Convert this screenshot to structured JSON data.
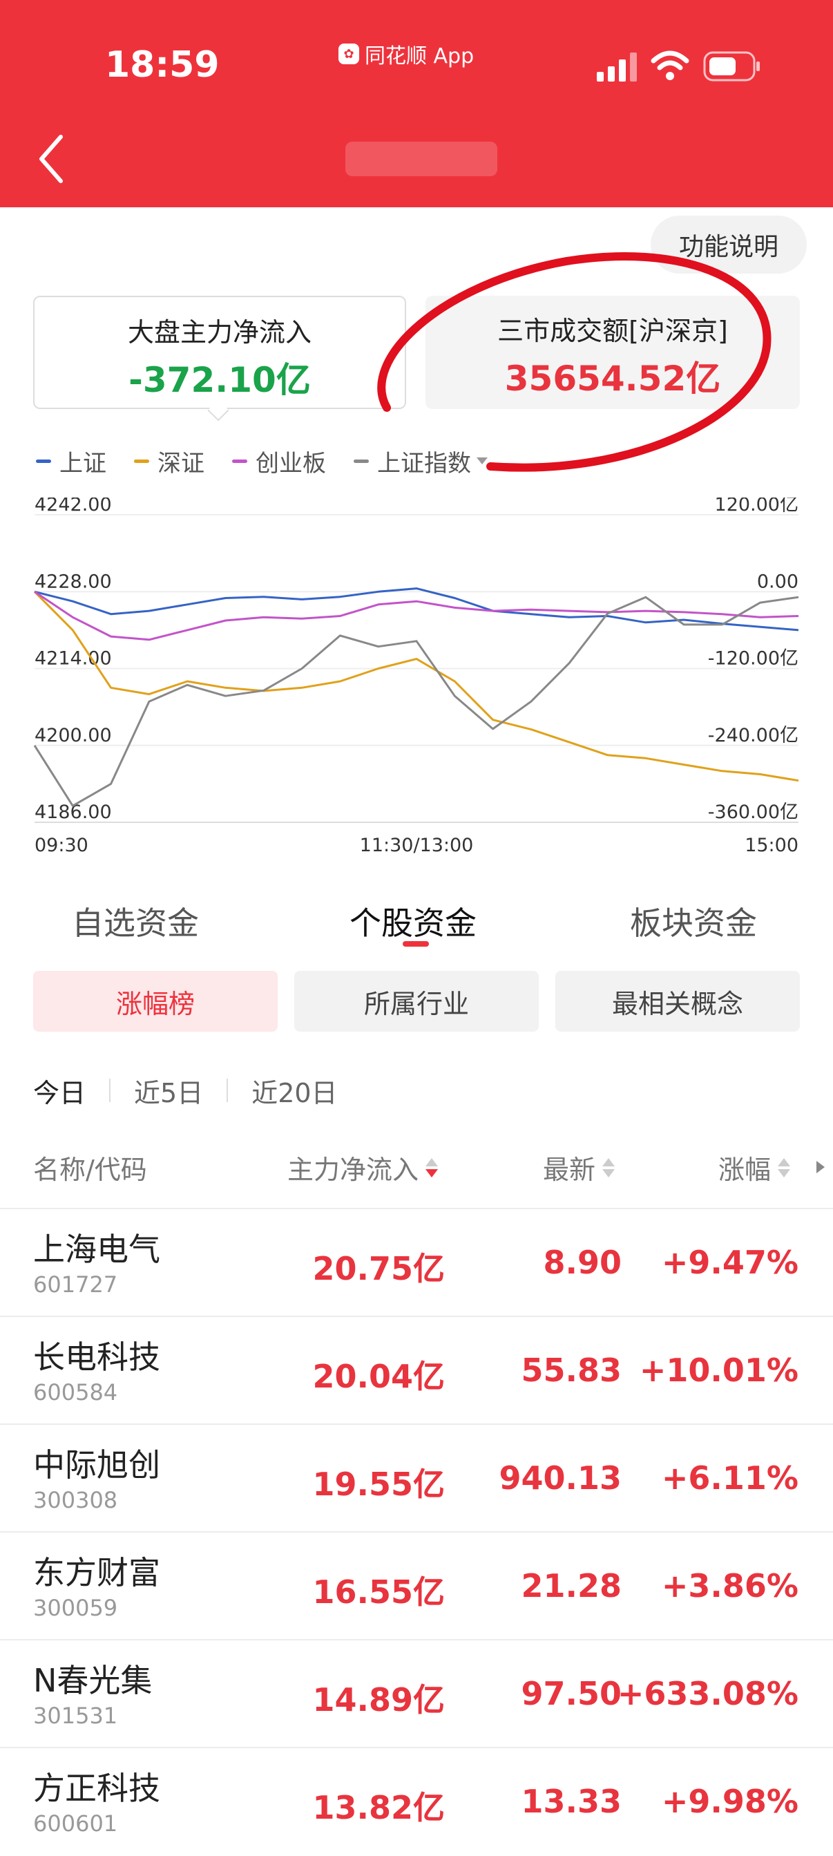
{
  "status_bar": {
    "time": "18:59",
    "app_badge": "同花顺 App"
  },
  "header": {
    "back_icon": "chevron-left-icon"
  },
  "help_button": "功能说明",
  "cards": {
    "net_inflow": {
      "label": "大盘主力净流入",
      "value": "-372.10亿",
      "color": "#1aa34a"
    },
    "turnover": {
      "label": "三市成交额[沪深京]",
      "value": "35654.52亿",
      "color": "#e8343e"
    }
  },
  "legend": [
    {
      "name": "上证",
      "color": "#3563c6"
    },
    {
      "name": "深证",
      "color": "#e0a11a"
    },
    {
      "name": "创业板",
      "color": "#c254c9"
    },
    {
      "name": "上证指数",
      "color": "#888888"
    }
  ],
  "chart_data": {
    "type": "line",
    "x_labels": [
      "09:30",
      "11:30/13:00",
      "15:00"
    ],
    "y_left_ticks": [
      "4242.00",
      "4228.00",
      "4214.00",
      "4200.00",
      "4186.00"
    ],
    "y_right_ticks": [
      "120.00亿",
      "0.00",
      "-120.00亿",
      "-240.00亿",
      "-360.00亿"
    ],
    "ylim_left": [
      4186,
      4242
    ],
    "ylim_right": [
      -360,
      120
    ],
    "x": [
      0,
      0.05,
      0.1,
      0.15,
      0.2,
      0.25,
      0.3,
      0.35,
      0.4,
      0.45,
      0.5,
      0.55,
      0.6,
      0.65,
      0.7,
      0.75,
      0.8,
      0.85,
      0.9,
      0.95,
      1.0
    ],
    "series": [
      {
        "name": "上证",
        "color": "#3563c6",
        "values": [
          0,
          -15,
          -35,
          -30,
          -20,
          -10,
          -8,
          -12,
          -8,
          0,
          5,
          -10,
          -30,
          -35,
          -40,
          -38,
          -48,
          -44,
          -50,
          -55,
          -60
        ]
      },
      {
        "name": "深证",
        "color": "#e0a11a",
        "values": [
          0,
          -60,
          -150,
          -160,
          -140,
          -150,
          -155,
          -150,
          -140,
          -120,
          -105,
          -140,
          -200,
          -215,
          -235,
          -255,
          -260,
          -270,
          -280,
          -285,
          -295
        ]
      },
      {
        "name": "创业板",
        "color": "#c254c9",
        "values": [
          0,
          -40,
          -70,
          -75,
          -60,
          -45,
          -40,
          -42,
          -38,
          -20,
          -15,
          -25,
          -30,
          -28,
          -30,
          -32,
          -30,
          -32,
          -35,
          -40,
          -38
        ]
      },
      {
        "name": "上证指数",
        "color": "#888888",
        "values": [
          4200,
          4189,
          4193,
          4208,
          4211,
          4209,
          4210,
          4214,
          4220,
          4218,
          4219,
          4209,
          4203,
          4208,
          4215,
          4224,
          4227,
          4222,
          4222,
          4226,
          4227
        ]
      }
    ]
  },
  "tabs": {
    "t1": "自选资金",
    "t2": "个股资金",
    "t3": "板块资金"
  },
  "filters": {
    "p1": "涨幅榜",
    "p2": "所属行业",
    "p3": "最相关概念"
  },
  "periods": {
    "a": "今日",
    "b": "近5日",
    "c": "近20日"
  },
  "table": {
    "headers": {
      "name": "名称/代码",
      "inflow": "主力净流入",
      "price": "最新",
      "change": "涨幅"
    },
    "rows": [
      {
        "name": "上海电气",
        "code": "601727",
        "inflow": "20.75亿",
        "price": "8.90",
        "change": "+9.47%"
      },
      {
        "name": "长电科技",
        "code": "600584",
        "inflow": "20.04亿",
        "price": "55.83",
        "change": "+10.01%"
      },
      {
        "name": "中际旭创",
        "code": "300308",
        "inflow": "19.55亿",
        "price": "940.13",
        "change": "+6.11%"
      },
      {
        "name": "东方财富",
        "code": "300059",
        "inflow": "16.55亿",
        "price": "21.28",
        "change": "+3.86%"
      },
      {
        "name": "N春光集",
        "code": "301531",
        "inflow": "14.89亿",
        "price": "97.50",
        "change": "+633.08%"
      },
      {
        "name": "方正科技",
        "code": "600601",
        "inflow": "13.82亿",
        "price": "13.33",
        "change": "+9.98%"
      }
    ]
  }
}
